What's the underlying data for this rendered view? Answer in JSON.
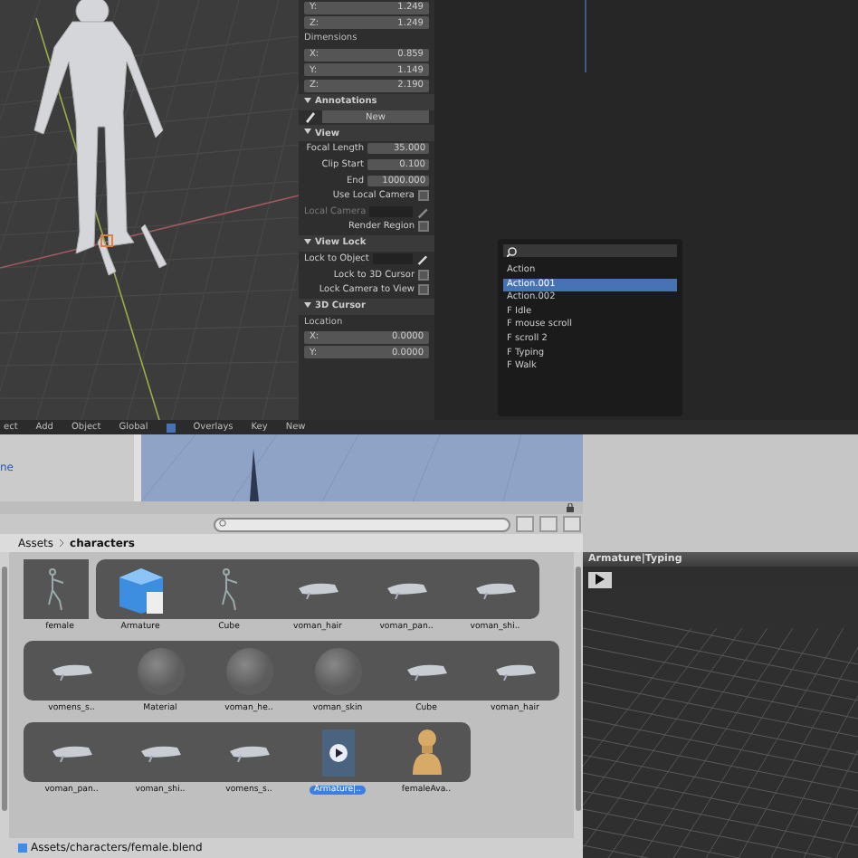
{
  "blender_header": {
    "items": [
      "ect",
      "Add",
      "Object",
      "Global",
      "Overlays",
      "Key",
      "New"
    ]
  },
  "properties": {
    "rows": [
      {
        "kind": "xyz",
        "label": "Y:",
        "value": "1.249"
      },
      {
        "kind": "xyz",
        "label": "Z:",
        "value": "1.249"
      },
      {
        "kind": "subheading",
        "label": "Dimensions"
      },
      {
        "kind": "xyz",
        "label": "X:",
        "value": "0.859"
      },
      {
        "kind": "xyz",
        "label": "Y:",
        "value": "1.149"
      },
      {
        "kind": "xyz",
        "label": "Z:",
        "value": "2.190"
      },
      {
        "kind": "header",
        "label": "Annotations",
        "expanded": true
      },
      {
        "kind": "new",
        "label": "New"
      },
      {
        "kind": "header",
        "label": "View",
        "expanded": true
      },
      {
        "kind": "field",
        "label": "Focal Length",
        "value": "35.000"
      },
      {
        "kind": "field",
        "label": "Clip Start",
        "value": "0.100"
      },
      {
        "kind": "field",
        "label": "End",
        "value": "1000.000"
      },
      {
        "kind": "check",
        "label": "Use Local Camera",
        "checked": false
      },
      {
        "kind": "picker",
        "label": "Local Camera",
        "disabled": true
      },
      {
        "kind": "check",
        "label": "Render Region",
        "checked": false
      },
      {
        "kind": "header",
        "label": "View Lock",
        "expanded": true
      },
      {
        "kind": "picker",
        "label": "Lock to Object",
        "disabled": false
      },
      {
        "kind": "check",
        "label": "Lock to 3D Cursor",
        "checked": false
      },
      {
        "kind": "check",
        "label": "Lock Camera to View",
        "checked": false
      },
      {
        "kind": "header",
        "label": "3D Cursor",
        "expanded": true
      },
      {
        "kind": "subheading",
        "label": "Location"
      },
      {
        "kind": "xyz",
        "label": "X:",
        "value": "0.0000"
      },
      {
        "kind": "xyz",
        "label": "Y:",
        "value": "0.0000"
      }
    ]
  },
  "action_menu": {
    "items": [
      {
        "label": "Action",
        "selected": false
      },
      {
        "label": "Action.001",
        "selected": true
      },
      {
        "label": "Action.002",
        "selected": false
      },
      {
        "label": "F Idle",
        "selected": false
      },
      {
        "label": "F mouse scroll",
        "selected": false
      },
      {
        "label": "F scroll 2",
        "selected": false
      },
      {
        "label": "F Typing",
        "selected": false
      },
      {
        "label": "F Walk",
        "selected": false
      }
    ]
  },
  "hierarchy": {
    "item": "ne"
  },
  "project": {
    "breadcrumb": [
      "Assets",
      "characters"
    ],
    "rows": [
      {
        "lead": {
          "label": "female",
          "kind": "model",
          "selected": false
        },
        "items": [
          {
            "label": "Armature",
            "kind": "prefab",
            "selected": false
          },
          {
            "label": "Cube",
            "kind": "model",
            "selected": false
          },
          {
            "label": "voman_hair",
            "kind": "mesh",
            "selected": false
          },
          {
            "label": "voman_pan..",
            "kind": "mesh",
            "selected": false
          },
          {
            "label": "voman_shi..",
            "kind": "mesh",
            "selected": false
          }
        ]
      },
      {
        "items": [
          {
            "label": "vomens_s..",
            "kind": "mesh",
            "selected": false
          },
          {
            "label": "Material",
            "kind": "material",
            "selected": false
          },
          {
            "label": "voman_he..",
            "kind": "material",
            "selected": false
          },
          {
            "label": "voman_skin",
            "kind": "material",
            "selected": false
          },
          {
            "label": "Cube",
            "kind": "mesh",
            "selected": false
          },
          {
            "label": "voman_hair",
            "kind": "mesh",
            "selected": false
          }
        ]
      },
      {
        "items": [
          {
            "label": "voman_pan..",
            "kind": "mesh",
            "selected": false
          },
          {
            "label": "voman_shi..",
            "kind": "mesh",
            "selected": false
          },
          {
            "label": "vomens_s..",
            "kind": "mesh",
            "selected": false
          },
          {
            "label": "Armature|..",
            "kind": "clip",
            "selected": true
          },
          {
            "label": "femaleAva..",
            "kind": "avatar",
            "selected": false
          }
        ]
      }
    ],
    "path": "Assets/characters/female.blend"
  },
  "preview": {
    "title": "Armature|Typing"
  }
}
